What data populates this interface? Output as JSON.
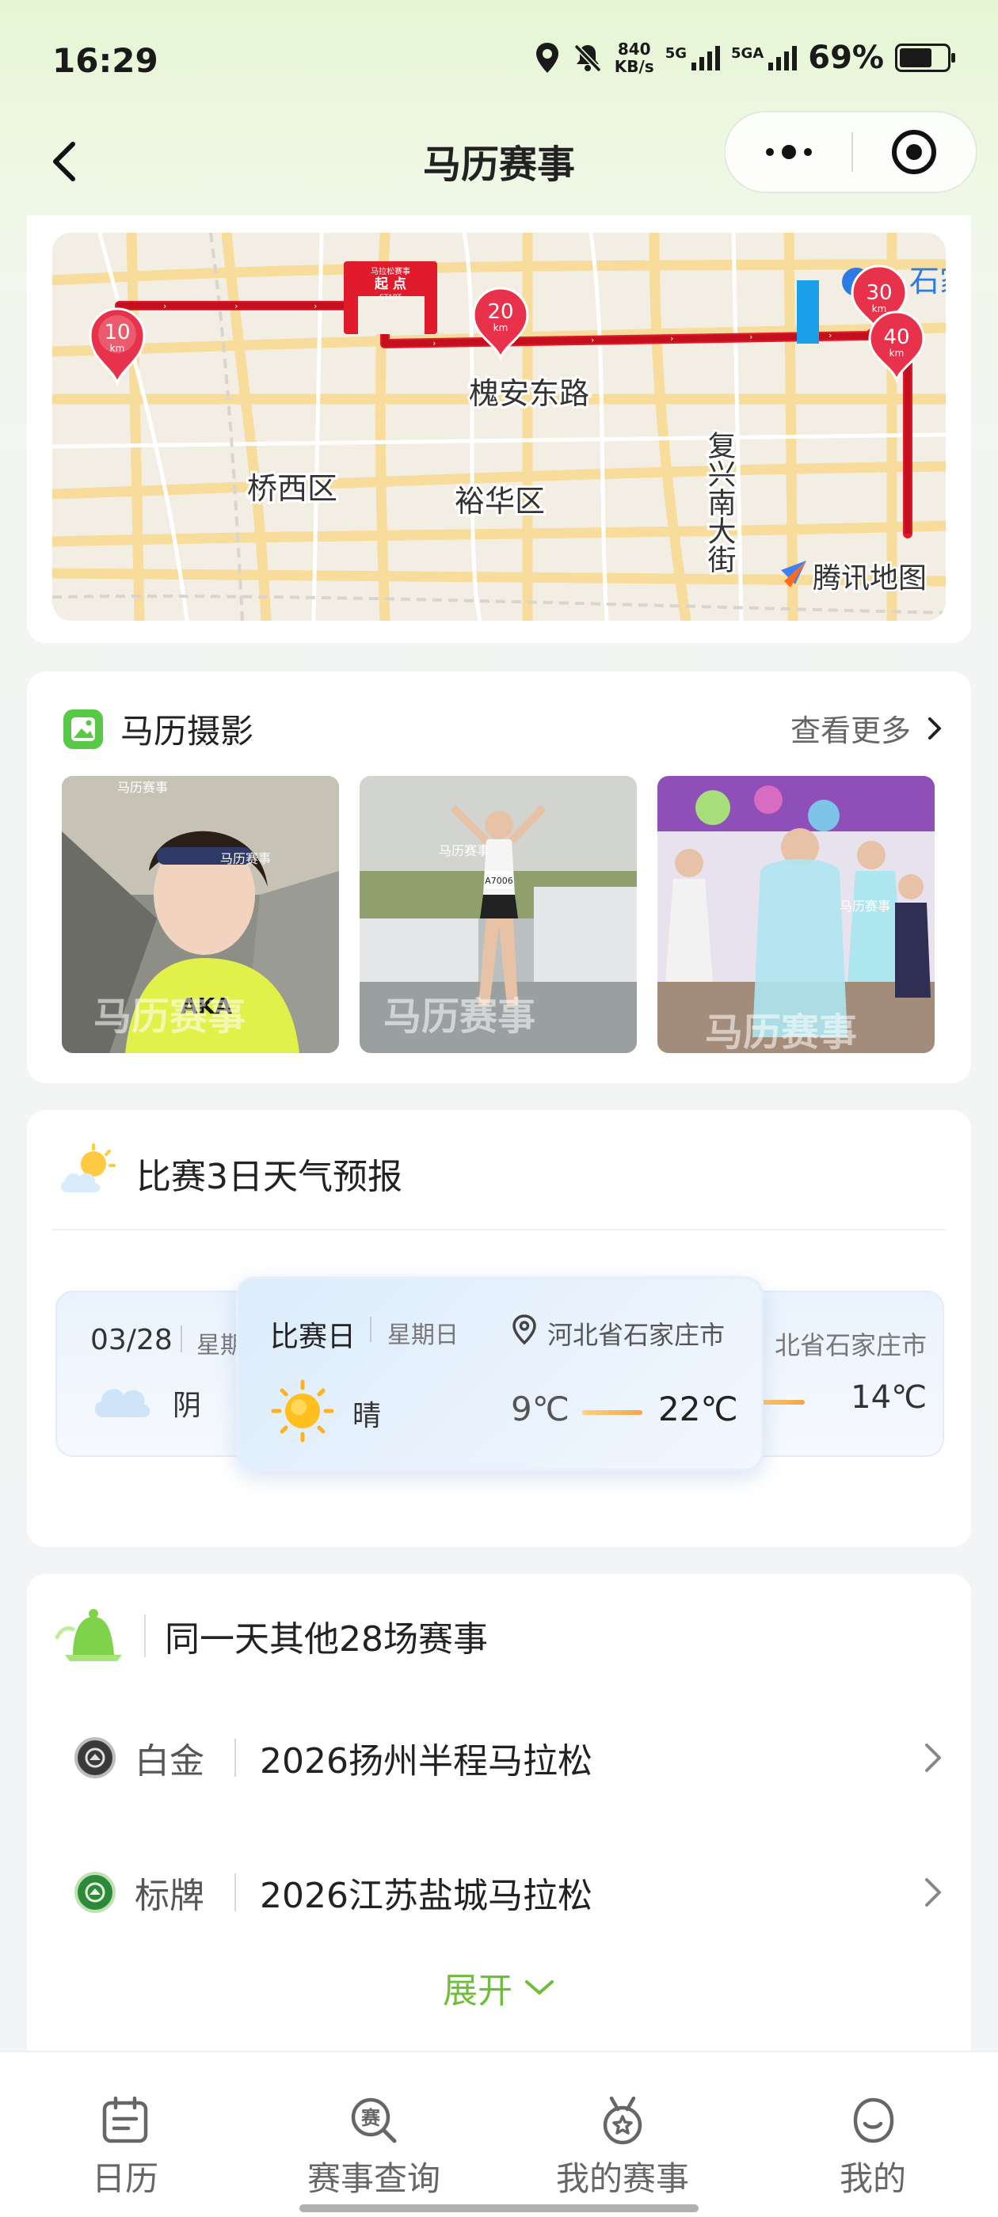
{
  "status": {
    "time": "16:29",
    "net_speed_value": "840",
    "net_speed_unit": "KB/s",
    "sim1": "5G",
    "sim2": "5GA",
    "battery": "69%"
  },
  "nav": {
    "title": "马历赛事"
  },
  "map": {
    "roads": {
      "r1": "槐安东路",
      "r2": "复兴南大街"
    },
    "districts": {
      "d1": "桥西区",
      "d2": "裕华区"
    },
    "start_label": "起 点",
    "start_sub": "START",
    "start_arch_top": "马拉松赛事",
    "km_markers": {
      "m10": "10",
      "m20": "20",
      "m30": "30",
      "m40": "40",
      "unit": "km"
    },
    "partial_label": "石家",
    "attribution": "腾讯地图"
  },
  "photos": {
    "title": "马历摄影",
    "more": "查看更多",
    "watermark": "马历赛事",
    "bib": "A7006"
  },
  "weather": {
    "title": "比赛3日天气预报",
    "left_day": {
      "date": "03/28",
      "weekday": "星期",
      "condition": "阴"
    },
    "race_day": {
      "label": "比赛日",
      "weekday": "星期日",
      "location": "河北省石家庄市",
      "condition": "晴",
      "low": "9℃",
      "high": "22℃"
    },
    "right_day": {
      "location": "北省石家庄市",
      "high": "14℃"
    }
  },
  "races": {
    "title": "同一天其他28场赛事",
    "items": [
      {
        "level": "白金",
        "name": "2026扬州半程马拉松"
      },
      {
        "level": "标牌",
        "name": "2026江苏盐城马拉松"
      }
    ],
    "expand": "展开"
  },
  "tabs": {
    "t1": "日历",
    "t2": "赛事查询",
    "t2_glyph": "赛",
    "t3": "我的赛事",
    "t4": "我的"
  }
}
